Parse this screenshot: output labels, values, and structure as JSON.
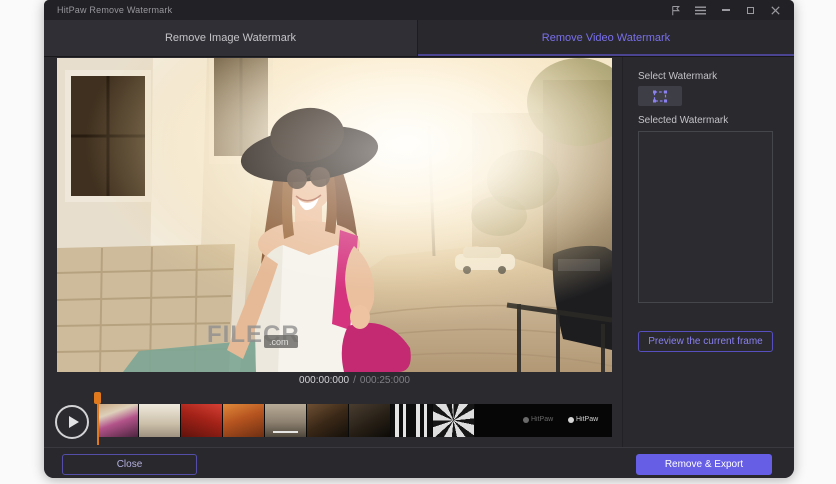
{
  "titlebar": {
    "title": "HitPaw Remove Watermark"
  },
  "tabs": [
    {
      "label": "Remove Image Watermark",
      "active": false
    },
    {
      "label": "Remove Video Watermark",
      "active": true
    }
  ],
  "video": {
    "overlay_watermark": "FILECR",
    "overlay_watermark_suffix": ".com"
  },
  "player": {
    "current_time": "000:00:000",
    "separator": "/",
    "total_time": "000:25:000"
  },
  "timeline": {
    "clip_watermark_1": "HitPaw",
    "clip_watermark_2": "HitPaw"
  },
  "sidebar": {
    "select_label": "Select Watermark",
    "selected_label": "Selected Watermark",
    "preview_button": "Preview the current frame"
  },
  "footer": {
    "close_button": "Close",
    "export_button": "Remove & Export"
  },
  "icons": {
    "feedback": "flag",
    "menu": "hamburger",
    "minimize": "horizontal-line",
    "maximize": "square-outline",
    "close": "x-cross",
    "play": "triangle-in-circle",
    "select_watermark": "dashed-marquee-rectangle"
  },
  "colors": {
    "accent_purple": "#675ee6",
    "active_tab_text": "#7a70ea",
    "playhead_orange": "#e0791e",
    "window_background": "#2a2a2f"
  }
}
